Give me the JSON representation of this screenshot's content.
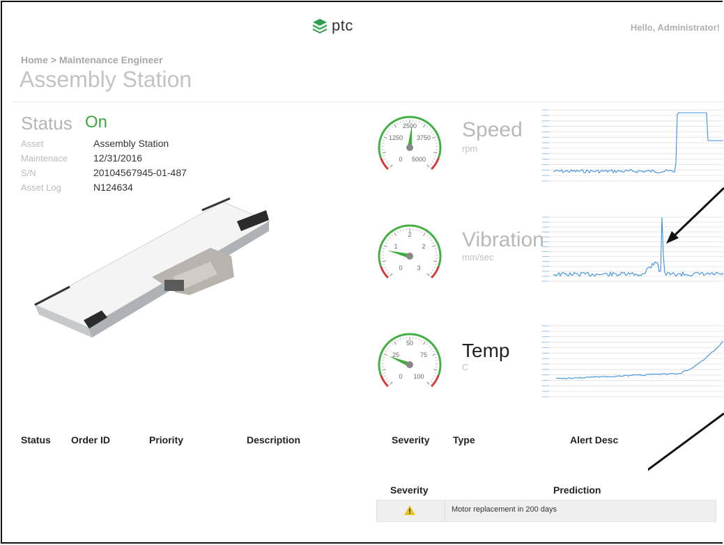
{
  "header": {
    "logo_text": "ptc",
    "greeting": "Hello, Administrator!"
  },
  "breadcrumb": {
    "home": "Home",
    "separator": " > ",
    "current": "Maintenance Engineer"
  },
  "page_title": "Assembly Station",
  "asset": {
    "status_label": "Status",
    "status_value": "On",
    "status_color": "#3aab3a",
    "labels": [
      "Asset",
      "Maintenace",
      "S/N",
      "Asset Log"
    ],
    "values": [
      "Assembly Station",
      "12/31/2016",
      "20104567945-01-487",
      "N124634"
    ]
  },
  "metrics": [
    {
      "name": "Speed",
      "unit": "rpm",
      "gauge_ticks": [
        "2500",
        "1250",
        "3750",
        "0",
        "5000"
      ],
      "gauge_value_fraction": 0.52
    },
    {
      "name": "Vibration",
      "unit": "mm/sec",
      "gauge_ticks": [
        "2",
        "1",
        "2",
        "0",
        "3"
      ],
      "gauge_value_fraction": 0.22
    },
    {
      "name": "Temp",
      "unit": "C",
      "gauge_ticks": [
        "50",
        "25",
        "75",
        "0",
        "100"
      ],
      "gauge_value_fraction": 0.25
    }
  ],
  "colors": {
    "gauge_green": "#44b044",
    "gauge_red": "#d83a3a",
    "needle": "#3fae3f",
    "sparkline": "#3b8fe0",
    "warning": "#e8c31c"
  },
  "work_orders": {
    "columns": [
      "Status",
      "Order ID",
      "Priority",
      "Description"
    ]
  },
  "alerts": {
    "columns": [
      "Severity",
      "Type",
      "Alert Desc"
    ]
  },
  "predictions": {
    "columns": [
      "Severity",
      "Prediction"
    ],
    "rows": [
      {
        "severity_icon": "warning-icon",
        "text": "Motor replacement in 200 days"
      }
    ]
  }
}
